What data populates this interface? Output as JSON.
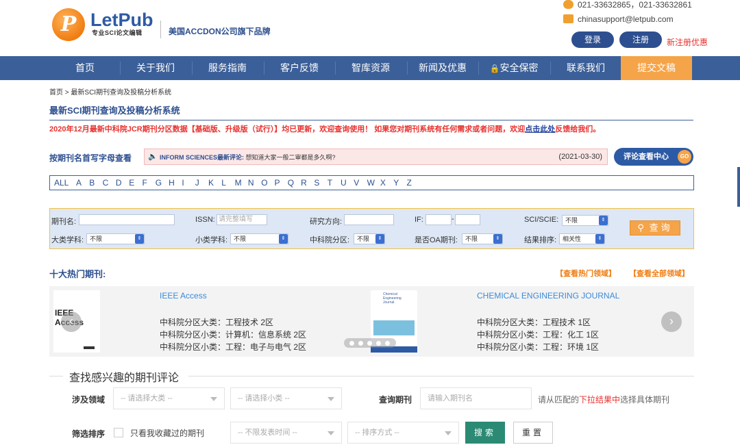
{
  "header": {
    "logo_letter": "P",
    "logo_name": "LetPub",
    "logo_sub": "专业SCI论文编辑",
    "brand": "美国ACCDON公司旗下品牌",
    "phone": "021-33632865，021-33632861",
    "email": "chinasupport@letpub.com",
    "login": "登录",
    "register": "注册",
    "register_promo": "新注册优惠"
  },
  "nav": {
    "items": [
      "首页",
      "关于我们",
      "服务指南",
      "客户反馈",
      "智库资源",
      "新闻及优惠",
      "安全保密",
      "联系我们",
      "提交文稿"
    ],
    "active_index": 8,
    "active_color": "#f5a449",
    "bar_color": "#3b5f98"
  },
  "breadcrumb": "首页 > 最新SCI期刊查询及投稿分析系统",
  "page_title": "最新SCI期刊查询及投稿分析系统",
  "notice": {
    "text": "2020年12月最新中科院JCR期刊分区数据【基础版、升级版（试行）】均已更新，欢迎查询使用！ 如果您对期刊系统有任何需求或者问题，欢迎",
    "link": "点击此处",
    "tail": "反馈给我们。"
  },
  "letter_nav": {
    "label": "按期刊名首写字母查看",
    "letters": [
      "ALL",
      "A",
      "B",
      "C",
      "D",
      "E",
      "F",
      "G",
      "H",
      "I",
      "J",
      "K",
      "L",
      "M",
      "N",
      "O",
      "P",
      "Q",
      "R",
      "S",
      "T",
      "U",
      "V",
      "W",
      "X",
      "Y",
      "Z"
    ]
  },
  "latest_review": {
    "journal": "INFORM SCIENCES最新评论:",
    "text": "想知道大家一般二审都是多久啊?",
    "date": "(2021-03-30)",
    "center_button": "评论查看中心",
    "go": "GO"
  },
  "search": {
    "journal_name_label": "期刊名:",
    "issn_label": "ISSN:",
    "issn_placeholder": "请完整填写",
    "research_label": "研究方向:",
    "if_label": "IF:",
    "if_sep": "-",
    "sci_label": "SCI/SCIE:",
    "sci_value": "不限",
    "major_label": "大类学科:",
    "major_value": "不限",
    "minor_label": "小类学科:",
    "minor_value": "不限",
    "cas_label": "中科院分区:",
    "cas_value": "不限",
    "oa_label": "是否OA期刊:",
    "oa_value": "不限",
    "sort_label": "结果排序:",
    "sort_value": "相关性",
    "query_button": "查询"
  },
  "hot": {
    "title": "十大热门期刊:",
    "link_hot": "【查看热门领域】",
    "link_all": "【查看全部领域】",
    "journals": [
      {
        "name": "IEEE Access",
        "cover_text": "IEEE Access",
        "lines": [
          "中科院分区大类：工程技术 2区",
          "中科院分区小类：计算机：信息系统 2区",
          "中科院分区小类：工程：电子与电气 2区"
        ]
      },
      {
        "name": "CHEMICAL ENGINEERING JOURNAL",
        "cover_text": "Chemical Engineering Journal",
        "lines": [
          "中科院分区大类：工程技术 1区",
          "中科院分区小类：工程：化工 1区",
          "中科院分区小类：工程：环境 1区"
        ]
      }
    ]
  },
  "review_search": {
    "title": "查找感兴趣的期刊评论",
    "field_label": "涉及领域",
    "major_placeholder": "-- 请选择大类 --",
    "minor_placeholder": "-- 请选择小类 --",
    "query_label": "查询期刊",
    "query_placeholder": "请输入期刊名",
    "hint_prefix": "请从匹配的",
    "hint_red": "下拉结果中",
    "hint_suffix": "选择具体期刊",
    "sort_label": "筛选排序",
    "only_favorites": "只看我收藏过的期刊",
    "time_placeholder": "-- 不限发表时间 --",
    "order_placeholder": "-- 排序方式 --",
    "search_button": "搜索",
    "reset_button": "重置"
  }
}
